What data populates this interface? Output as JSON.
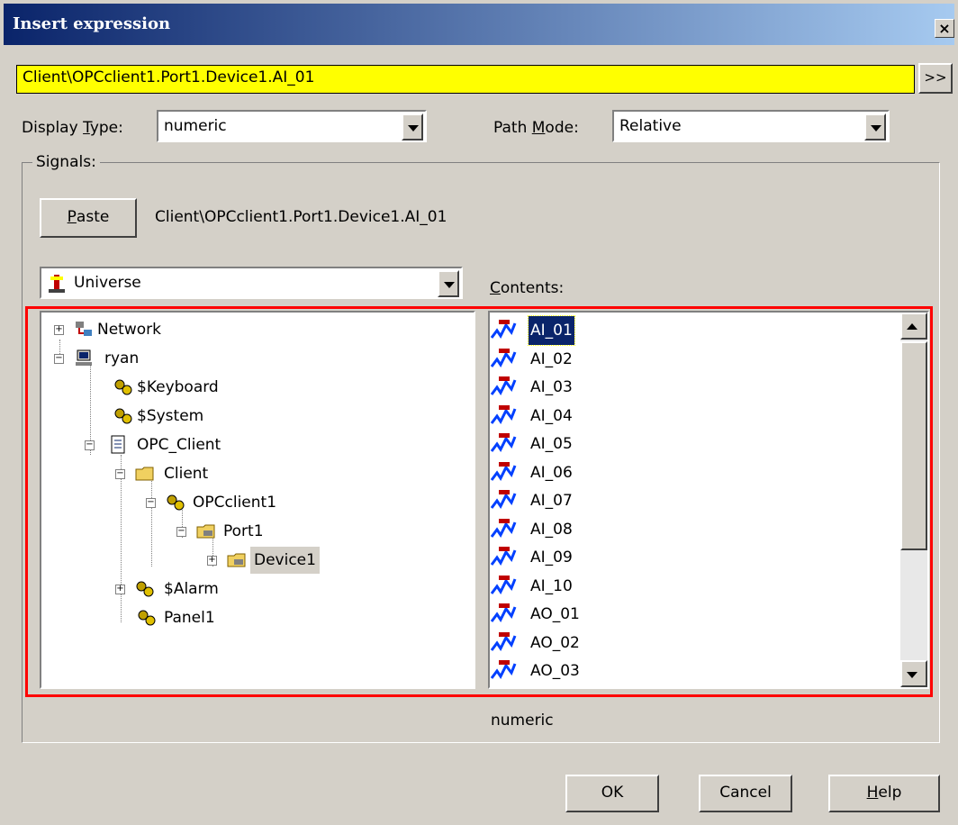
{
  "window": {
    "title": "Insert expression",
    "close_label": "×"
  },
  "expression": {
    "value": "Client\\OPCclient1.Port1.Device1.AI_01",
    "more_label": ">>"
  },
  "display_type": {
    "label_pre": "Display ",
    "label_key": "T",
    "label_post": "ype:",
    "value": "numeric"
  },
  "path_mode": {
    "label_pre": "Path ",
    "label_key": "M",
    "label_post": "ode:",
    "value": "Relative"
  },
  "signals": {
    "group_label": "Signals:",
    "paste_label_key": "P",
    "paste_label_rest": "aste",
    "current_path": "Client\\OPCclient1.Port1.Device1.AI_01",
    "universe": "Universe",
    "contents_label_key": "C",
    "contents_label_rest": "ontents:",
    "status_type": "numeric"
  },
  "tree": [
    {
      "label": "Network",
      "icon": "network-icon"
    },
    {
      "label": "ryan",
      "icon": "computer-icon"
    },
    {
      "label": "$Keyboard",
      "icon": "gears-icon"
    },
    {
      "label": "$System",
      "icon": "gears-icon"
    },
    {
      "label": "OPC_Client",
      "icon": "document-icon"
    },
    {
      "label": "Client",
      "icon": "folder-icon"
    },
    {
      "label": "OPCclient1",
      "icon": "gears-icon"
    },
    {
      "label": "Port1",
      "icon": "port-folder-icon"
    },
    {
      "label": "Device1",
      "icon": "device-folder-icon"
    },
    {
      "label": "$Alarm",
      "icon": "gears-icon"
    },
    {
      "label": "Panel1",
      "icon": "gears-icon"
    }
  ],
  "contents": [
    "AI_01",
    "AI_02",
    "AI_03",
    "AI_04",
    "AI_05",
    "AI_06",
    "AI_07",
    "AI_08",
    "AI_09",
    "AI_10",
    "AO_01",
    "AO_02",
    "AO_03"
  ],
  "selected_content": "AI_01",
  "buttons": {
    "ok": "OK",
    "cancel": "Cancel",
    "help_key": "H",
    "help_rest": "elp"
  },
  "colors": {
    "title_start": "#0a246a",
    "title_end": "#a6caf0",
    "expression_bg": "#ffff00",
    "highlight_frame": "#ff0000"
  }
}
